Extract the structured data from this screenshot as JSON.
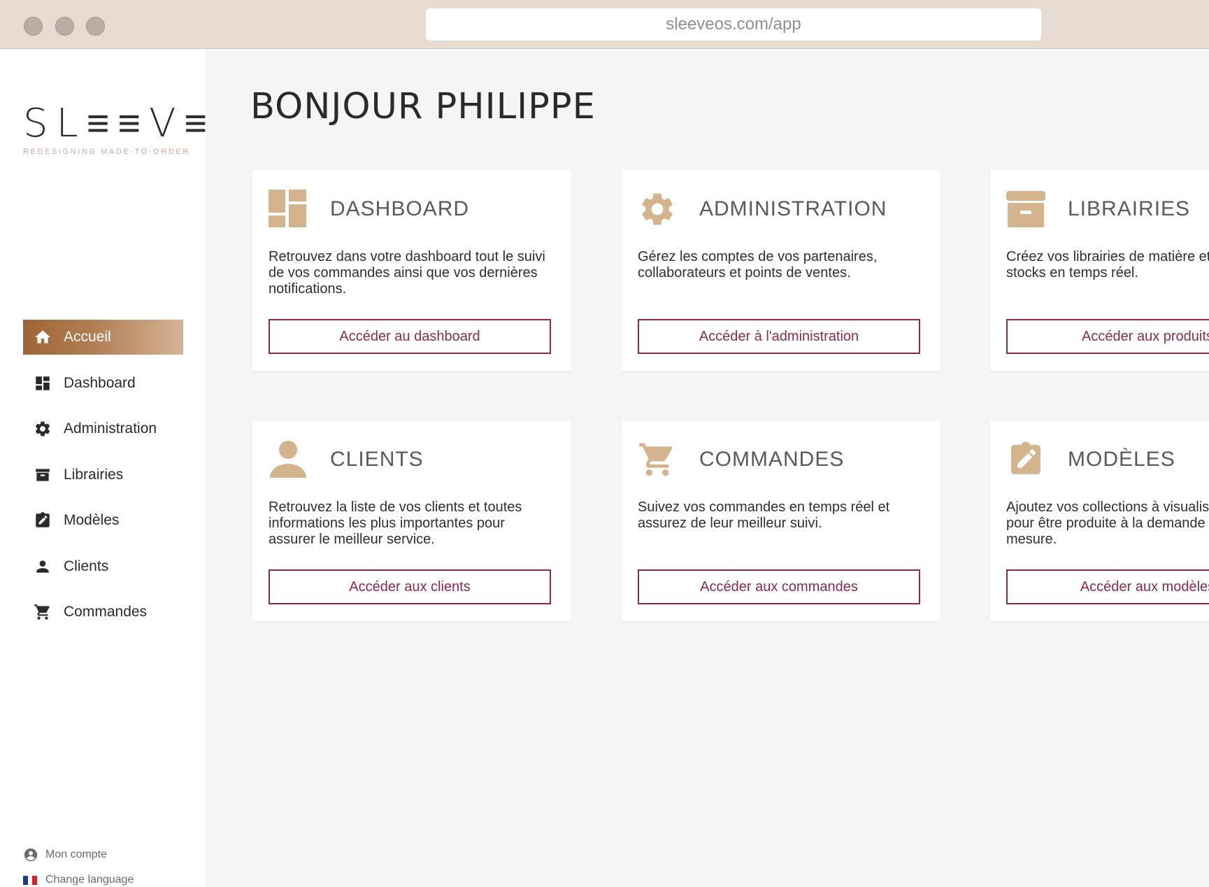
{
  "browser": {
    "url": "sleeveos.com/app"
  },
  "brand": {
    "name": "SL≡≡V≡",
    "tagline": "REDESIGNING MADE-TO-ORDER"
  },
  "sidebar": {
    "items": [
      {
        "label": "Accueil",
        "icon": "home-icon",
        "active": true
      },
      {
        "label": "Dashboard",
        "icon": "dashboard-icon"
      },
      {
        "label": "Administration",
        "icon": "gear-icon"
      },
      {
        "label": "Librairies",
        "icon": "archive-icon"
      },
      {
        "label": "Modèles",
        "icon": "clipboard-edit-icon"
      },
      {
        "label": "Clients",
        "icon": "person-icon"
      },
      {
        "label": "Commandes",
        "icon": "cart-icon"
      }
    ],
    "bottom": {
      "account": "Mon compte",
      "language": "Change language"
    }
  },
  "main": {
    "title": "BONJOUR PHILIPPE",
    "cards": [
      {
        "title": "DASHBOARD",
        "icon": "dashboard-icon",
        "description": "Retrouvez dans votre dashboard tout le suivi de vos commandes ainsi que vos dernières notifications.",
        "button": "Accéder au dashboard"
      },
      {
        "title": "ADMINISTRATION",
        "icon": "gear-icon",
        "description": "Gérez les comptes de vos partenaires, collaborateurs et points de ventes.",
        "button": "Accéder à l'administration"
      },
      {
        "title": "LIBRAIRIES",
        "icon": "archive-icon",
        "description": "Créez vos librairies de matière et suivez vos stocks en temps réel.",
        "button": "Accéder aux produits"
      },
      {
        "title": "CLIENTS",
        "icon": "person-icon",
        "description": "Retrouvez la liste de vos clients et toutes informations les plus importantes pour assurer le meilleur service.",
        "button": "Accéder aux clients"
      },
      {
        "title": "COMMANDES",
        "icon": "cart-icon",
        "description": "Suivez  vos commandes en temps réel et assurez de leur meilleur suivi.",
        "button": "Accéder aux commandes"
      },
      {
        "title": "MODÈLES",
        "icon": "clipboard-edit-icon",
        "description": "Ajoutez vos collections à visualiser et prête pour être produite à la demande ou sur-mesure.",
        "button": "Accéder aux modèles"
      }
    ]
  },
  "colors": {
    "accent_gold": "#d4b48c",
    "button_border": "#8b2b4c",
    "active_gradient_start": "#9d6535",
    "active_gradient_end": "#d6b597",
    "logo_tagline": "#d4a797"
  }
}
